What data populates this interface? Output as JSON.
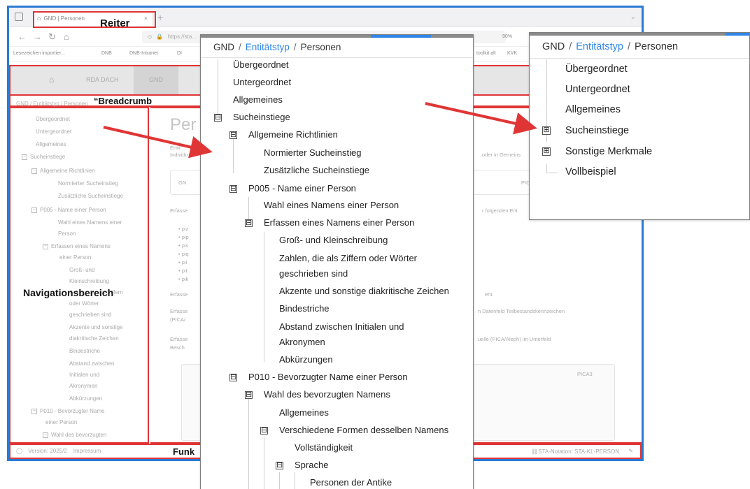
{
  "browser": {
    "tab_title": "GND | Personen",
    "tab_close": "×",
    "new_tab": "+",
    "url": "https://sta...",
    "zoom": "90%",
    "bookmarks": [
      {
        "label": "Lesezeichen importier..."
      },
      {
        "label": "DNB"
      },
      {
        "label": "DNB-Intranet"
      },
      {
        "label": "DI"
      },
      {
        "label": "toolkit alt"
      },
      {
        "label": "KVK"
      }
    ],
    "site_nav": {
      "rda": "RDA DACH",
      "gnd": "GND"
    },
    "breadcrumb": {
      "parts": [
        "GND",
        "Entitätstyp",
        "Personen"
      ]
    },
    "page_title": "Per",
    "nav_items": [
      "Übergeordnet",
      "Untergeordnet",
      "Allgemeines",
      "Sucheinstiege",
      "Allgemeine Richtlinien",
      "Normierter Sucheinstieg",
      "Zusätzliche Sucheinstiege",
      "P005 - Name einer Person",
      "Wahl eines Namens einer",
      "Person",
      "Erfassen eines Namens",
      "einer Person",
      "Groß- und",
      "Kleinschreibung",
      "Zahlen, die als Ziffern",
      "oder Wörter",
      "geschrieben sind",
      "Akzente und sonstige",
      "diakritische Zeichen",
      "Bindestriche",
      "Abstand zwischen",
      "Initialen und",
      "Akronymen",
      "Abkürzungen",
      "P010 - Bevorzugter Name",
      "einer Person",
      "Wahl des bevorzugten"
    ],
    "content_snippets": {
      "s1": "Entit",
      "s2": "Individu",
      "s3": "oder in Gemeins",
      "s4": "GN",
      "s5": "PIC",
      "s6": "Erfasse",
      "s7": "r folgenden Ent",
      "bullets": [
        "• piz",
        "• pip",
        "• pis",
        "• piq",
        "• pii",
        "• pit",
        "• pik"
      ],
      "s8": "Erfasse",
      "s9": "eht.",
      "s10": "Erfasse",
      "s11": "(PICA/",
      "s12": "n Datenfeld Teilbestandskennzeichen",
      "s13": "Erfasse",
      "s14": "Besch",
      "s15": "uelle (PICA/Aleph) im Unterfeld",
      "s16": "PICA3"
    },
    "footer": {
      "version": "Version: 2025/2",
      "impressum": "Impressum",
      "sta": "STA-Notation: STA-KL-PERSON"
    }
  },
  "labels": {
    "reiter": "Reiter",
    "breadcrumb": "“Breadcrumb",
    "navigation": "Navigationsbereich",
    "funk": "Funk"
  },
  "panel_mid": {
    "breadcrumb": {
      "root": "GND",
      "sep": "/",
      "link": "Entitätstyp",
      "current": "Personen"
    },
    "items": [
      {
        "label": "Übergeordnet"
      },
      {
        "label": "Untergeordnet"
      },
      {
        "label": "Allgemeines"
      },
      {
        "label": "Sucheinstiege",
        "toggle": "⊟"
      },
      {
        "label": "Allgemeine Richtlinien",
        "toggle": "⊟"
      },
      {
        "label": "Normierter Sucheinstieg"
      },
      {
        "label": "Zusätzliche Sucheinstiege"
      },
      {
        "label": "P005 - Name einer Person",
        "toggle": "⊟"
      },
      {
        "label": "Wahl eines Namens einer Person"
      },
      {
        "label": "Erfassen eines Namens einer Person",
        "toggle": "⊟"
      },
      {
        "label": "Groß- und Kleinschreibung"
      },
      {
        "label": "Zahlen, die als Ziffern oder Wörter",
        "label2": "geschrieben sind"
      },
      {
        "label": "Akzente und sonstige diakritische Zeichen"
      },
      {
        "label": "Bindestriche"
      },
      {
        "label": "Abstand zwischen Initialen und",
        "label2": "Akronymen"
      },
      {
        "label": "Abkürzungen"
      },
      {
        "label": "P010 - Bevorzugter Name einer Person",
        "toggle": "⊟"
      },
      {
        "label": "Wahl des bevorzugten Namens",
        "toggle": "⊟"
      },
      {
        "label": "Allgemeines"
      },
      {
        "label": "Verschiedene Formen desselben Namens",
        "toggle": "⊟"
      },
      {
        "label": "Vollständigkeit"
      },
      {
        "label": "Sprache",
        "toggle": "⊟"
      },
      {
        "label": "Personen der Antike"
      }
    ]
  },
  "panel_right": {
    "breadcrumb": {
      "root": "GND",
      "sep": "/",
      "link": "Entitätstyp",
      "current": "Personen"
    },
    "items": [
      {
        "label": "Übergeordnet"
      },
      {
        "label": "Untergeordnet"
      },
      {
        "label": "Allgemeines"
      },
      {
        "label": "Sucheinstiege",
        "toggle": "⊞"
      },
      {
        "label": "Sonstige Merkmale",
        "toggle": "⊞"
      },
      {
        "label": "Vollbeispiel"
      }
    ]
  },
  "colors": {
    "annotation_red": "#e03535",
    "link_blue": "#2f86e8",
    "window_blue": "#2b7bd3"
  }
}
